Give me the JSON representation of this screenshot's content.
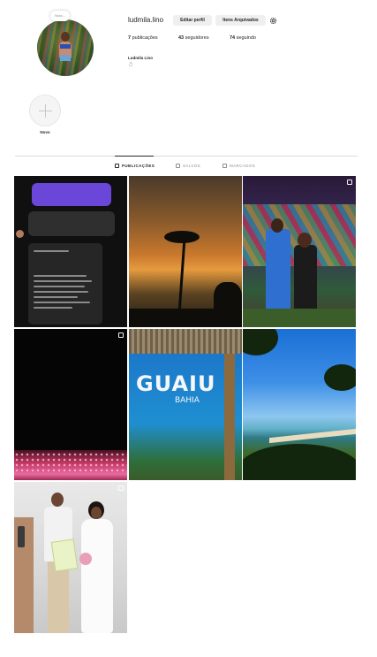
{
  "profile": {
    "username": "ludmila.lino",
    "note_label": "Nota...",
    "edit_profile_label": "Editar perfil",
    "archive_label": "Itens Arquivados",
    "posts_count": "7",
    "posts_label": "publicações",
    "followers_count": "43",
    "followers_label": "seguidores",
    "following_count": "74",
    "following_label": "seguindo",
    "full_name": "Ludmila Lino",
    "bio_icon": "💍"
  },
  "highlights": {
    "new_label": "Novo"
  },
  "tabs": [
    {
      "label": "PUBLICAÇÕES",
      "icon": "grid-icon",
      "active": true
    },
    {
      "label": "SALVOS",
      "icon": "bookmark-icon",
      "active": false
    },
    {
      "label": "MARCADOS",
      "icon": "tag-icon",
      "active": false
    }
  ],
  "posts": [
    {
      "type": "screenshot",
      "multiple": false
    },
    {
      "type": "photo",
      "multiple": false
    },
    {
      "type": "photo",
      "multiple": true
    },
    {
      "type": "photo",
      "multiple": true
    },
    {
      "type": "photo",
      "multiple": false
    },
    {
      "type": "photo",
      "multiple": false
    },
    {
      "type": "photo",
      "multiple": true
    }
  ],
  "post_texts": {
    "sign_main": "GUAIU",
    "sign_sub": "BAHIA"
  },
  "colors": {
    "text": "#262626",
    "muted": "#8e8e8e",
    "button_bg": "#efefef",
    "divider": "#dbdbdb"
  }
}
